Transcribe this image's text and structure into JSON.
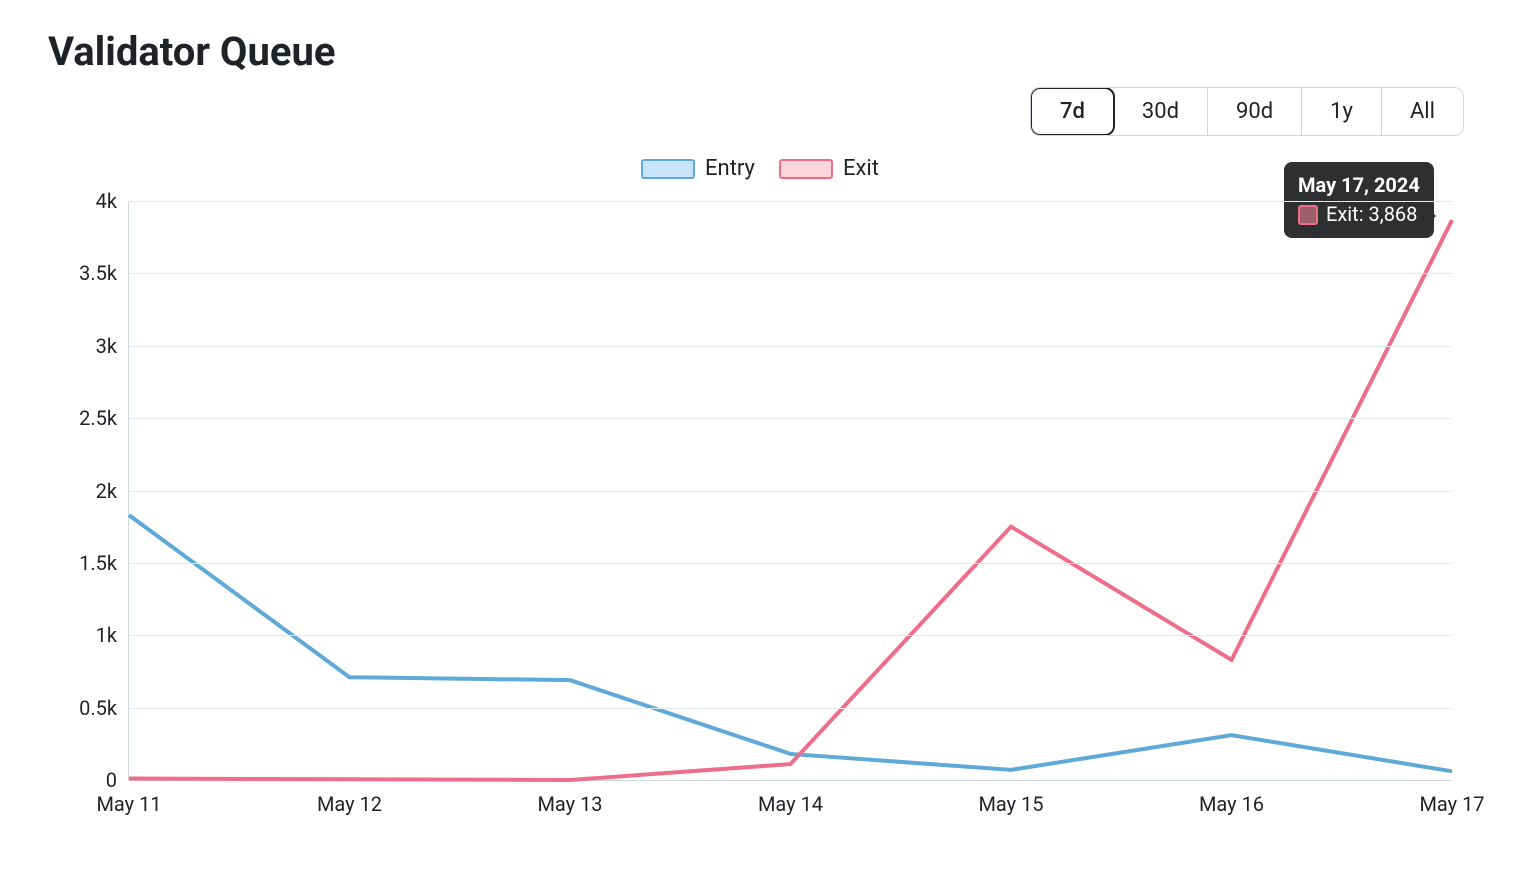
{
  "title": "Validator Queue",
  "ranges": [
    "7d",
    "30d",
    "90d",
    "1y",
    "All"
  ],
  "active_range": "7d",
  "legend": {
    "entry": "Entry",
    "exit": "Exit"
  },
  "tooltip": {
    "title": "May 17, 2024",
    "series_label": "Exit",
    "value": "3,868"
  },
  "chart_data": {
    "type": "line",
    "xlabel": "",
    "ylabel": "",
    "ylim": [
      0,
      4000
    ],
    "y_ticks": [
      0,
      500,
      1000,
      1500,
      2000,
      2500,
      3000,
      3500,
      4000
    ],
    "y_tick_labels": [
      "0",
      "0.5k",
      "1k",
      "1.5k",
      "2k",
      "2.5k",
      "3k",
      "3.5k",
      "4k"
    ],
    "categories": [
      "May 11",
      "May 12",
      "May 13",
      "May 14",
      "May 15",
      "May 16",
      "May 17"
    ],
    "series": [
      {
        "name": "Entry",
        "color": "#5fa9d8",
        "values": [
          1830,
          710,
          690,
          180,
          70,
          310,
          60
        ]
      },
      {
        "name": "Exit",
        "color": "#ee6e89",
        "values": [
          10,
          5,
          0,
          110,
          1750,
          830,
          3868
        ]
      }
    ]
  }
}
